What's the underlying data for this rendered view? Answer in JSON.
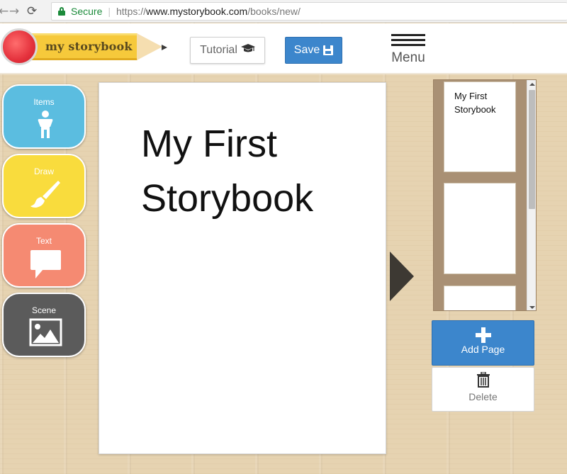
{
  "browser": {
    "back_icon": "←",
    "forward_icon": "→",
    "reload_icon": "⟳",
    "secure_label": "Secure",
    "url_protocol": "https://",
    "url_host": "www.mystorybook.com",
    "url_path": "/books/new/"
  },
  "header": {
    "logo_text": "my storybook",
    "tutorial_label": "Tutorial",
    "save_label": "Save",
    "menu_label": "Menu"
  },
  "tools": [
    {
      "label": "Items",
      "color": "#5bbde0",
      "icon": "person-icon"
    },
    {
      "label": "Draw",
      "color": "#f9dc3d",
      "icon": "paintbrush-icon"
    },
    {
      "label": "Text",
      "color": "#f58a72",
      "icon": "speech-bubble-icon"
    },
    {
      "label": "Scene",
      "color": "#5b5b5b",
      "icon": "image-icon"
    }
  ],
  "page": {
    "title": "My First Storybook"
  },
  "thumbnails": {
    "pages": [
      {
        "title": "My First Storybook"
      },
      {
        "title": ""
      },
      {
        "title": ""
      }
    ]
  },
  "actions": {
    "add_page_label": "Add Page",
    "delete_label": "Delete"
  },
  "colors": {
    "primary_blue": "#3c86cc",
    "eraser_red": "#e4313c",
    "pencil_yellow": "#f6c93b",
    "wood": "#e6d3b1"
  }
}
